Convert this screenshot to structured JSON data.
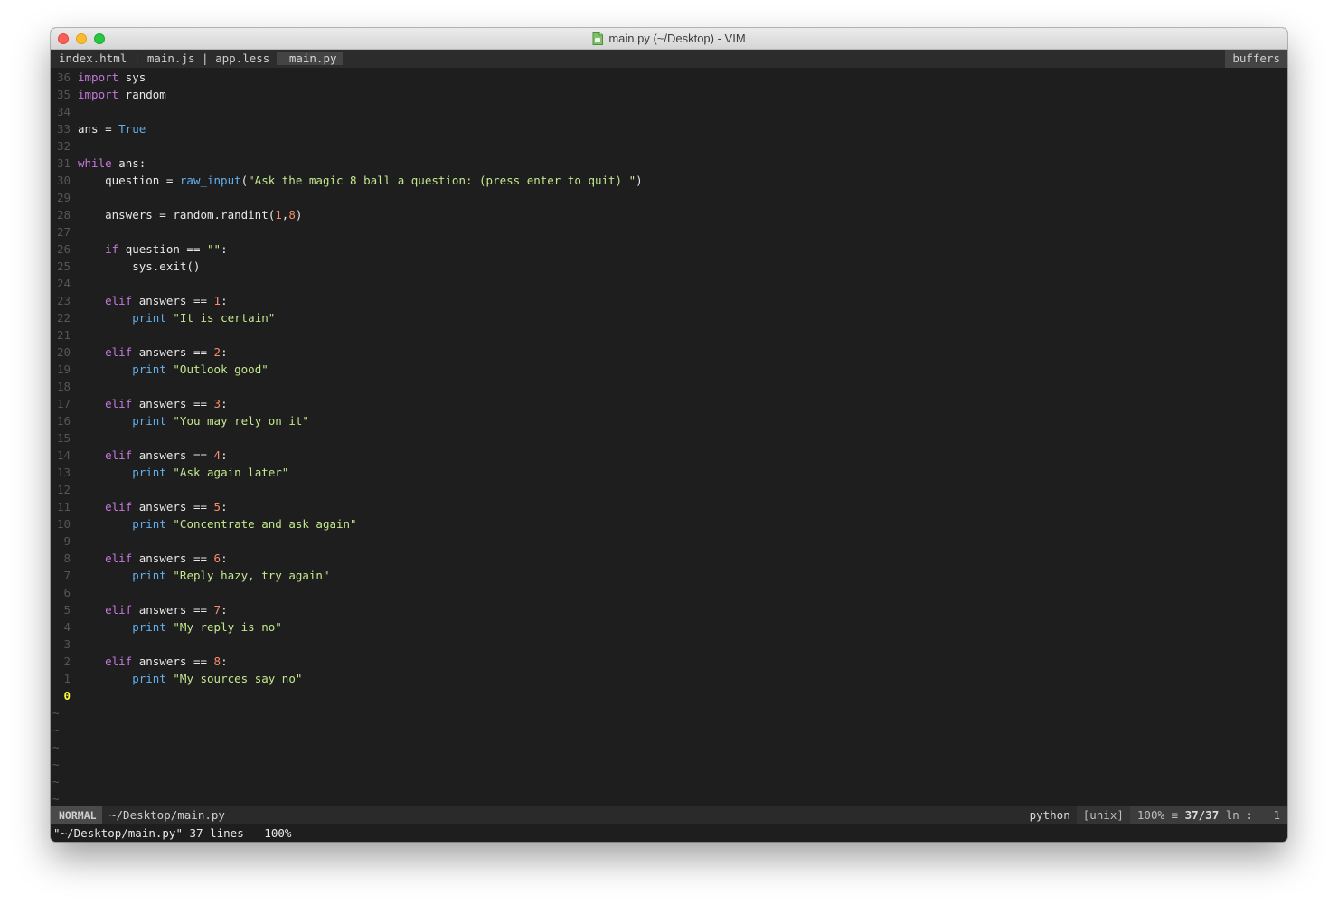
{
  "window": {
    "title": "main.py (~/Desktop) - VIM"
  },
  "tabline": {
    "inactive_tabs": "index.html | main.js | app.less",
    "active_tab": "main.py",
    "buffers_label": "buffers"
  },
  "editor": {
    "current_line_number": "0",
    "tilde": "~",
    "lines": [
      {
        "ln": "36",
        "code": "import sys"
      },
      {
        "ln": "35",
        "code": "import random"
      },
      {
        "ln": "34",
        "code": ""
      },
      {
        "ln": "33",
        "code": "ans = True"
      },
      {
        "ln": "32",
        "code": ""
      },
      {
        "ln": "31",
        "code": "while ans:"
      },
      {
        "ln": "30",
        "code": "    question = raw_input(\"Ask the magic 8 ball a question: (press enter to quit) \")"
      },
      {
        "ln": "29",
        "code": ""
      },
      {
        "ln": "28",
        "code": "    answers = random.randint(1,8)"
      },
      {
        "ln": "27",
        "code": ""
      },
      {
        "ln": "26",
        "code": "    if question == \"\":"
      },
      {
        "ln": "25",
        "code": "        sys.exit()"
      },
      {
        "ln": "24",
        "code": ""
      },
      {
        "ln": "23",
        "code": "    elif answers == 1:"
      },
      {
        "ln": "22",
        "code": "        print \"It is certain\""
      },
      {
        "ln": "21",
        "code": ""
      },
      {
        "ln": "20",
        "code": "    elif answers == 2:"
      },
      {
        "ln": "19",
        "code": "        print \"Outlook good\""
      },
      {
        "ln": "18",
        "code": ""
      },
      {
        "ln": "17",
        "code": "    elif answers == 3:"
      },
      {
        "ln": "16",
        "code": "        print \"You may rely on it\""
      },
      {
        "ln": "15",
        "code": ""
      },
      {
        "ln": "14",
        "code": "    elif answers == 4:"
      },
      {
        "ln": "13",
        "code": "        print \"Ask again later\""
      },
      {
        "ln": "12",
        "code": ""
      },
      {
        "ln": "11",
        "code": "    elif answers == 5:"
      },
      {
        "ln": "10",
        "code": "        print \"Concentrate and ask again\""
      },
      {
        "ln": "9",
        "code": ""
      },
      {
        "ln": "8",
        "code": "    elif answers == 6:"
      },
      {
        "ln": "7",
        "code": "        print \"Reply hazy, try again\""
      },
      {
        "ln": "6",
        "code": ""
      },
      {
        "ln": "5",
        "code": "    elif answers == 7:"
      },
      {
        "ln": "4",
        "code": "        print \"My reply is no\""
      },
      {
        "ln": "3",
        "code": ""
      },
      {
        "ln": "2",
        "code": "    elif answers == 8:"
      },
      {
        "ln": "1",
        "code": "        print \"My sources say no\""
      }
    ]
  },
  "statusline": {
    "mode": "NORMAL",
    "file": "~/Desktop/main.py",
    "filetype": "python",
    "fileformat": "[unix]",
    "percent": "100%",
    "position": "37/37",
    "ln_label": "ln",
    "column": ":   1"
  },
  "cmdline": {
    "message": "\"~/Desktop/main.py\" 37 lines --100%--"
  },
  "colors": {
    "keyword": "#c678dd",
    "builtin": "#61afef",
    "string": "#c3e88d",
    "number": "#f78c6c",
    "current_line_nr": "#fefb3c",
    "background": "#1e1e1e"
  }
}
